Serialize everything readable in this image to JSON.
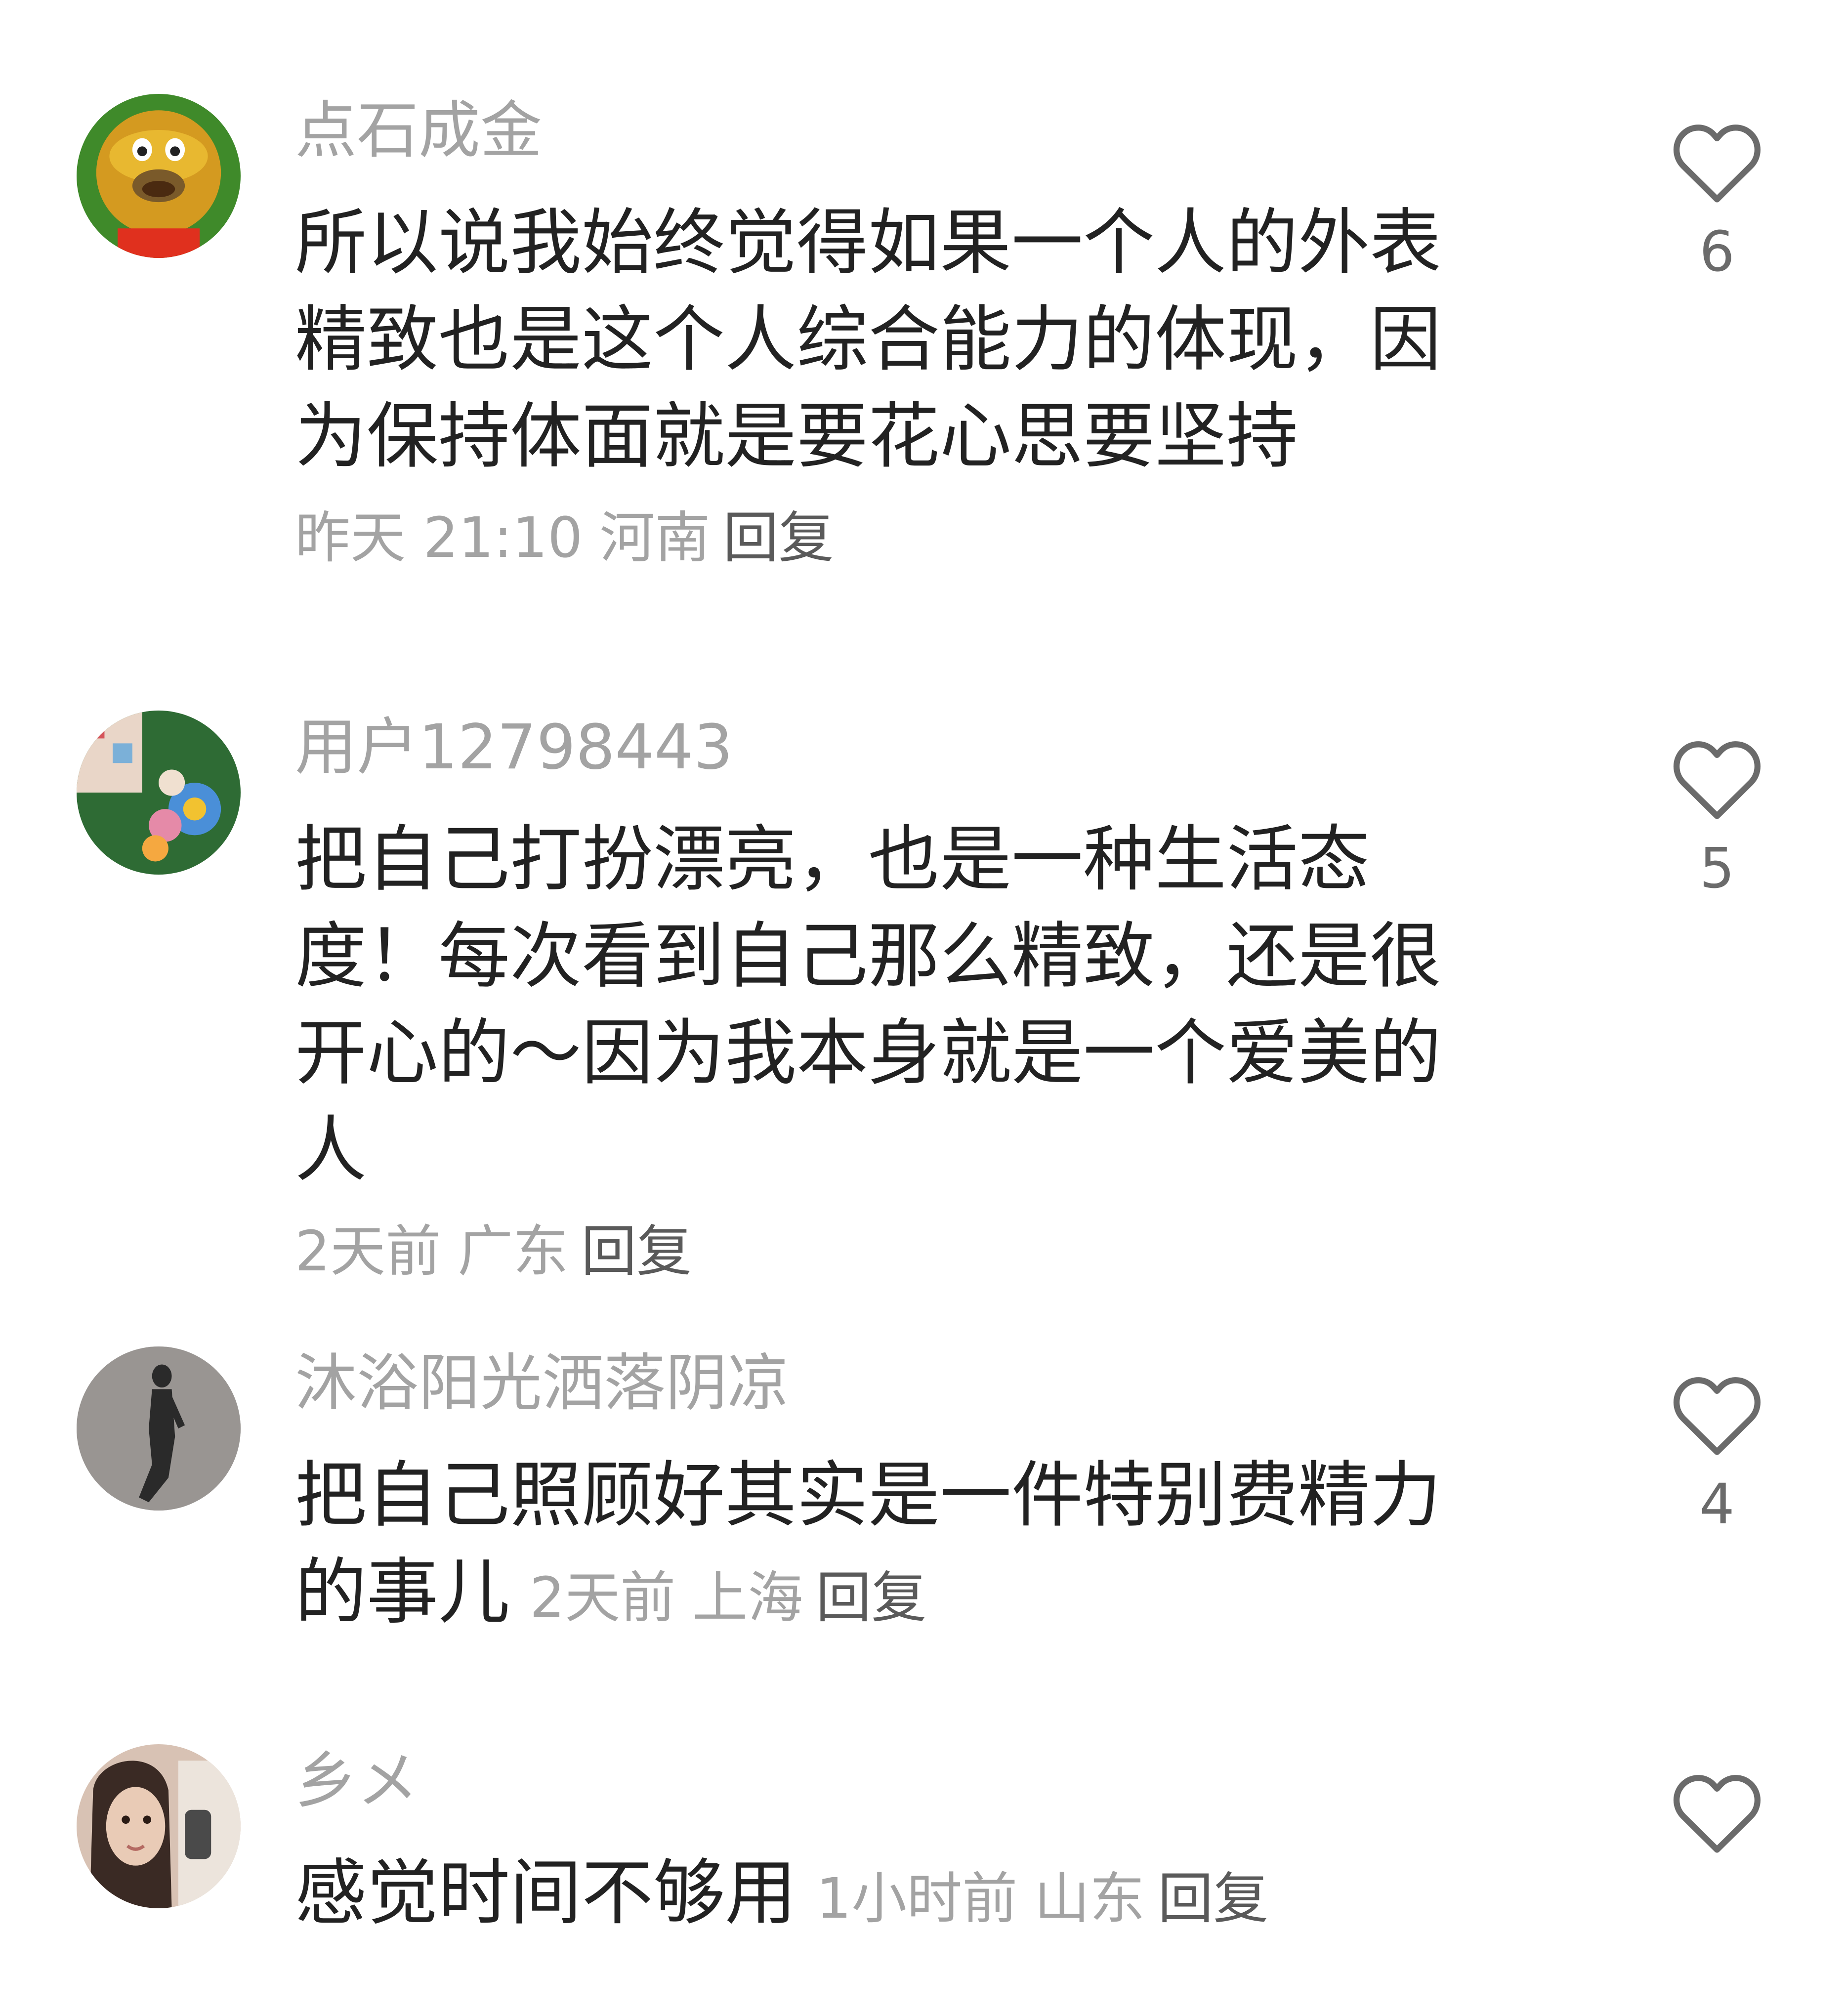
{
  "comments": [
    {
      "username": "点石成金",
      "text": "所以说我始终觉得如果一个人的外表精致也是这个人综合能力的体现，因为保持体面就是要花心思要坚持",
      "time": "昨天 21:10",
      "location": "河南",
      "reply_label": "回复",
      "likes": "6",
      "avatar_icon": "cartoon-avatar"
    },
    {
      "username": "用户12798443",
      "text": "把自己打扮漂亮，也是一种生活态度！每次看到自己那么精致，还是很开心的～因为我本身就是一个爱美的人",
      "time": "2天前",
      "location": "广东",
      "reply_label": "回复",
      "likes": "5",
      "avatar_icon": "plush-toys-avatar"
    },
    {
      "username": "沐浴阳光洒落阴凉",
      "text": "把自己照顾好其实是一件特别费精力的事儿",
      "time": "2天前",
      "location": "上海",
      "reply_label": "回复",
      "likes": "4",
      "avatar_icon": "shadow-avatar"
    },
    {
      "username": "乡メ",
      "text": "感觉时间不够用",
      "time": "1小时前",
      "location": "山东",
      "reply_label": "回复",
      "likes": "",
      "avatar_icon": "selfie-avatar"
    }
  ]
}
